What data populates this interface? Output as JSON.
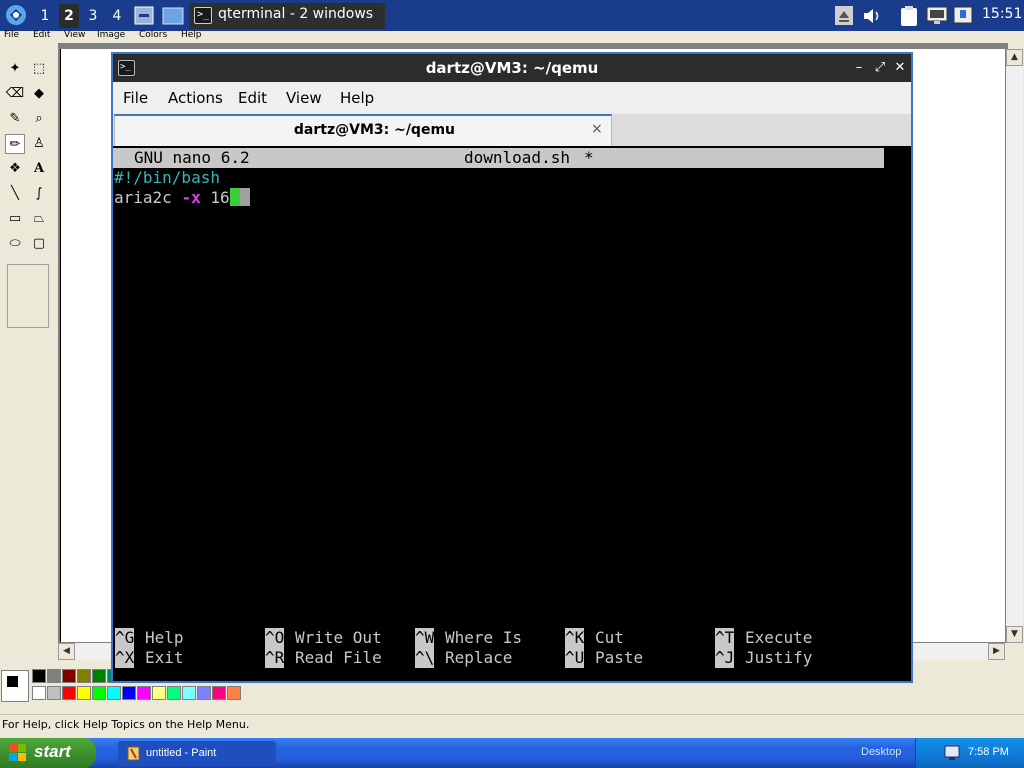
{
  "top_panel": {
    "desktops": [
      "1",
      "2",
      "3",
      "4"
    ],
    "active_desktop": "2",
    "task_label": "qterminal - 2 windows",
    "clock": "15:51"
  },
  "paint": {
    "menu": [
      "File",
      "Edit",
      "View",
      "Image",
      "Colors",
      "Help"
    ],
    "status": "For Help, click Help Topics on the Help Menu.",
    "palette_colors": [
      "#000000",
      "#808080",
      "#800000",
      "#808000",
      "#008000",
      "#008080",
      "#000080",
      "#800080",
      "#808040",
      "#004040",
      "#0080ff",
      "#004080",
      "#8000ff",
      "#804000",
      "#ffffff",
      "#c0c0c0",
      "#ff0000",
      "#ffff00",
      "#00ff00",
      "#00ffff",
      "#0000ff",
      "#ff00ff",
      "#ffff80",
      "#00ff80",
      "#80ffff",
      "#8080ff",
      "#ff0080",
      "#ff8040"
    ]
  },
  "qterminal": {
    "title": "dartz@VM3: ~/qemu",
    "menu": [
      "File",
      "Actions",
      "Edit",
      "View",
      "Help"
    ],
    "tab_label": "dartz@VM3: ~/qemu",
    "tab_close": "×",
    "nano": {
      "version": "GNU nano 6.2",
      "filename": "download.sh",
      "modified": "*",
      "line1": "#!/bin/bash",
      "line2_cmd": "aria2c ",
      "line2_flag": "-x",
      "line2_rest": " 16",
      "shortcuts_row1": [
        {
          "key": "^G",
          "label": "Help"
        },
        {
          "key": "^O",
          "label": "Write Out"
        },
        {
          "key": "^W",
          "label": "Where Is"
        },
        {
          "key": "^K",
          "label": "Cut"
        },
        {
          "key": "^T",
          "label": "Execute"
        }
      ],
      "shortcuts_row2": [
        {
          "key": "^X",
          "label": "Exit"
        },
        {
          "key": "^R",
          "label": "Read File"
        },
        {
          "key": "^\\",
          "label": "Replace"
        },
        {
          "key": "^U",
          "label": "Paste"
        },
        {
          "key": "^J",
          "label": "Justify"
        }
      ]
    }
  },
  "xp_taskbar": {
    "start_label": "start",
    "task_label": "untitled - Paint",
    "desktop_label": "Desktop",
    "clock": "7:58 PM"
  }
}
